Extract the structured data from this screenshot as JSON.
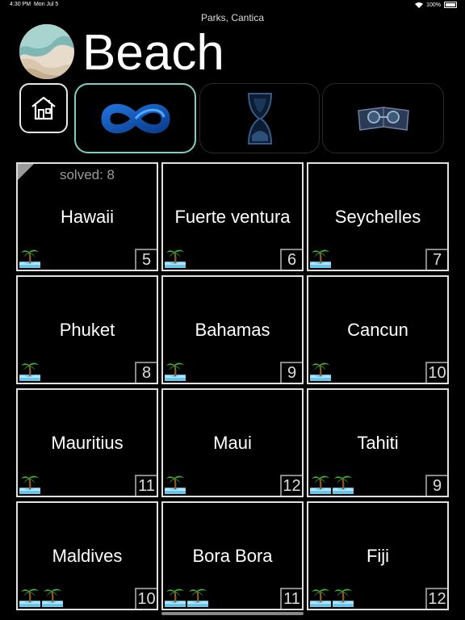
{
  "status_bar": {
    "time": "4:30 PM",
    "date": "Mon Jul 5",
    "battery": "100%"
  },
  "header": {
    "subtitle": "Parks, Cantica",
    "title": "Beach"
  },
  "tabs": [
    {
      "name": "home",
      "icon": "house-icon"
    },
    {
      "name": "infinity",
      "icon": "infinity-icon"
    },
    {
      "name": "hourglass",
      "icon": "hourglass-icon"
    },
    {
      "name": "book",
      "icon": "book-glasses-icon"
    }
  ],
  "levels": [
    {
      "name": "Hawaii",
      "number": "5",
      "palms": 1,
      "solved": "solved: 8"
    },
    {
      "name": "Fuerte ventura",
      "number": "6",
      "palms": 1
    },
    {
      "name": "Seychelles",
      "number": "7",
      "palms": 1
    },
    {
      "name": "Phuket",
      "number": "8",
      "palms": 1
    },
    {
      "name": "Bahamas",
      "number": "9",
      "palms": 1
    },
    {
      "name": "Cancun",
      "number": "10",
      "palms": 1
    },
    {
      "name": "Mauritius",
      "number": "11",
      "palms": 1
    },
    {
      "name": "Maui",
      "number": "12",
      "palms": 1
    },
    {
      "name": "Tahiti",
      "number": "9",
      "palms": 2
    },
    {
      "name": "Maldives",
      "number": "10",
      "palms": 2
    },
    {
      "name": "Bora Bora",
      "number": "11",
      "palms": 2
    },
    {
      "name": "Fiji",
      "number": "12",
      "palms": 2
    }
  ],
  "colors": {
    "active_tab_border": "#7fcfc0",
    "background": "#000000"
  }
}
